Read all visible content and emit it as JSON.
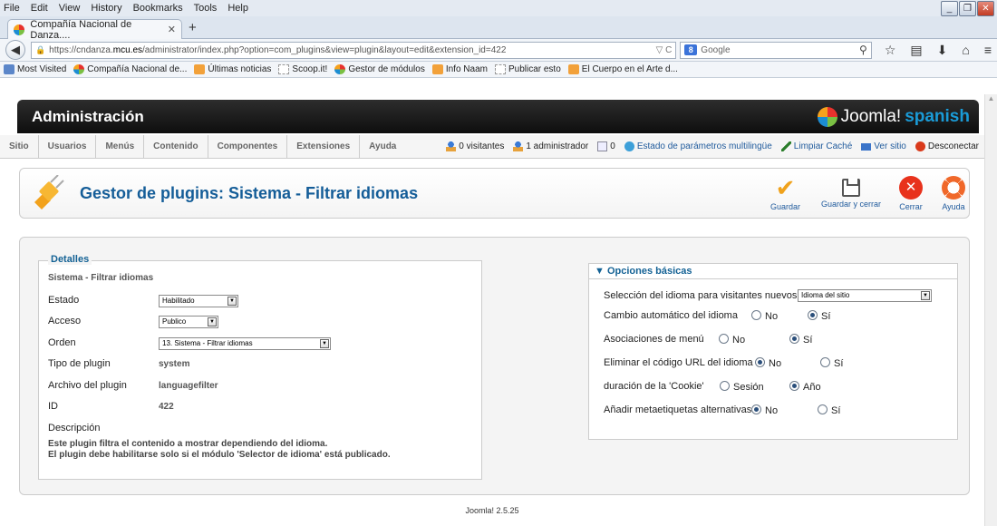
{
  "browser": {
    "menu": [
      "File",
      "Edit",
      "View",
      "History",
      "Bookmarks",
      "Tools",
      "Help"
    ],
    "tab_title": "Compañía Nacional de Danza....",
    "url_prefix": "https://cndanza.",
    "url_host": "mcu.es",
    "url_path": "/administrator/index.php?option=com_plugins&view=plugin&layout=edit&extension_id=422",
    "search_placeholder": "Google",
    "bookmarks": [
      {
        "label": "Most Visited",
        "icon": "blue"
      },
      {
        "label": "Compañía Nacional de...",
        "icon": "joomla"
      },
      {
        "label": "Últimas noticias",
        "icon": "rss"
      },
      {
        "label": "Scoop.it!",
        "icon": "page"
      },
      {
        "label": "Gestor de módulos",
        "icon": "joomla"
      },
      {
        "label": "Info Naam",
        "icon": "rss"
      },
      {
        "label": "Publicar esto",
        "icon": "page"
      },
      {
        "label": "El Cuerpo en el Arte d...",
        "icon": "rss"
      }
    ]
  },
  "header": {
    "title": "Administración",
    "logo_text": "Joomla!",
    "logo_lang": "spanish"
  },
  "submenu": {
    "items": [
      "Sitio",
      "Usuarios",
      "Menús",
      "Contenido",
      "Componentes",
      "Extensiones",
      "Ayuda"
    ],
    "status": {
      "visitors": "0 visitantes",
      "admins": "1 administrador",
      "messages": "0",
      "multilang": "Estado de parámetros multilingüe",
      "clear_cache": "Limpiar Caché",
      "view_site": "Ver sitio",
      "logout": "Desconectar"
    }
  },
  "toolbar": {
    "page_title": "Gestor de plugins: Sistema - Filtrar idiomas",
    "save": "Guardar",
    "save_close": "Guardar y cerrar",
    "close": "Cerrar",
    "help": "Ayuda"
  },
  "details": {
    "legend": "Detalles",
    "subtitle": "Sistema - Filtrar idiomas",
    "estado_label": "Estado",
    "estado_value": "Habilitado",
    "acceso_label": "Acceso",
    "acceso_value": "Publico",
    "orden_label": "Orden",
    "orden_value": "13. Sistema - Filtrar idiomas",
    "tipo_label": "Tipo de plugin",
    "tipo_value": "system",
    "archivo_label": "Archivo del plugin",
    "archivo_value": "languagefilter",
    "id_label": "ID",
    "id_value": "422",
    "descripcion_label": "Descripción",
    "desc_line1": "Este plugin filtra el contenido a mostrar dependiendo del idioma.",
    "desc_line2": "El plugin debe habilitarse solo si el módulo 'Selector de idioma' está publicado."
  },
  "options": {
    "header": "▼ Opciones básicas",
    "visitor_lang_label": "Selección del idioma para visitantes nuevos.",
    "visitor_lang_value": "Idioma del sitio",
    "auto_change_label": "Cambio automático del idioma",
    "menu_assoc_label": "Asociaciones de menú",
    "remove_url_label": "Eliminar el código URL del idioma",
    "cookie_label": "duración de la 'Cookie'",
    "alt_meta_label": "Añadir metaetiquetas alternativas",
    "no": "No",
    "si": "Sí",
    "session": "Sesión",
    "year": "Año"
  },
  "footer": "Joomla! 2.5.25"
}
